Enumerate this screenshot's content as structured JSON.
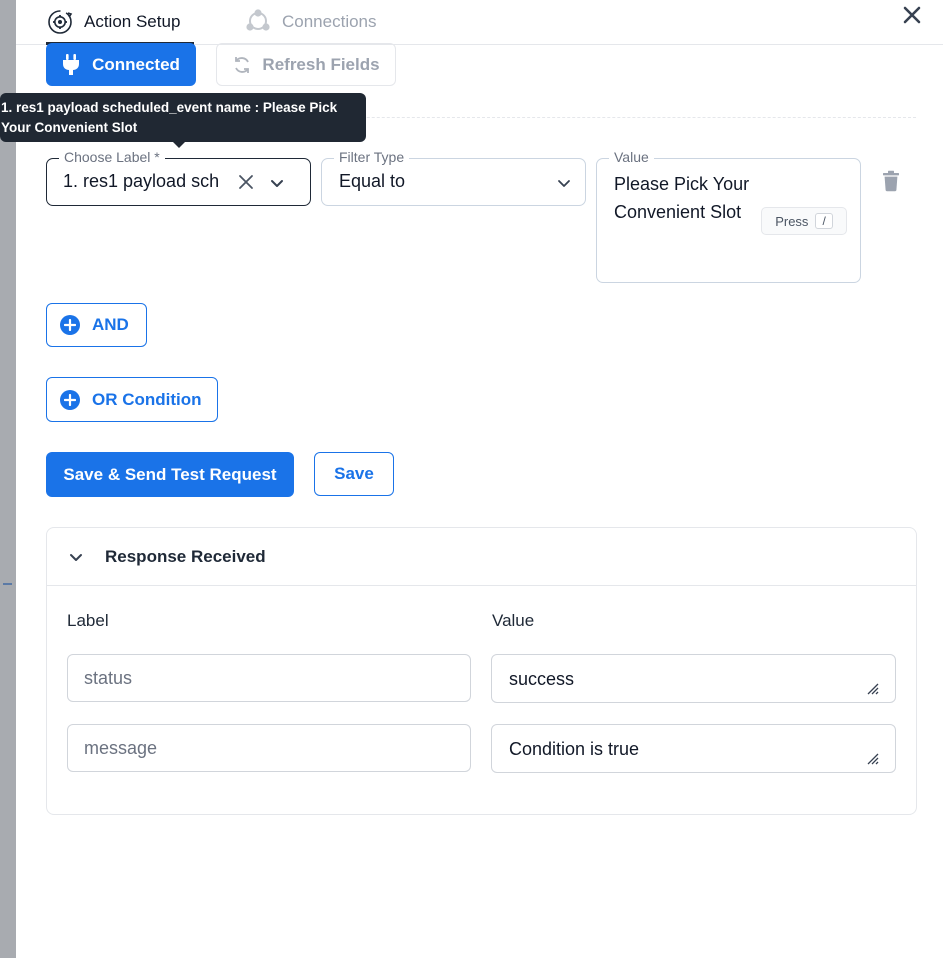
{
  "tabs": {
    "action_setup": "Action Setup",
    "connections": "Connections"
  },
  "toolbar": {
    "connected_label": "Connected",
    "refresh_label": "Refresh Fields"
  },
  "tooltip": {
    "line1": "1. res1 payload scheduled_event name : Please Pick",
    "line2": "Your Convenient Slot"
  },
  "condition": {
    "label_legend": "Choose Label *",
    "label_value": "1. res1 payload scheduled_event name",
    "filter_legend": "Filter Type",
    "filter_value": "Equal to",
    "value_legend": "Value",
    "value_text": "Please Pick Your Convenient Slot",
    "press_hint": "Press",
    "press_key": "/"
  },
  "buttons": {
    "and_label": "AND",
    "or_label": "OR Condition",
    "save_send_label": "Save & Send Test Request",
    "save_label": "Save"
  },
  "response": {
    "title": "Response Received",
    "col_label": "Label",
    "col_value": "Value",
    "rows": [
      {
        "label_placeholder": "status",
        "value": "success"
      },
      {
        "label_placeholder": "message",
        "value": "Condition is true"
      }
    ]
  },
  "colors": {
    "accent": "#1a73e8",
    "tooltip_bg": "#202833",
    "muted": "#9ca3af"
  },
  "icons": {
    "action_setup": "gear-cycle-icon",
    "connections": "network-icon",
    "close": "close-icon",
    "connected": "plug-icon",
    "refresh": "refresh-icon",
    "clear": "clear-x-icon",
    "dropdown": "chevron-down-icon",
    "delete": "trash-icon",
    "add": "plus-circle-icon",
    "collapse": "chevron-down-icon",
    "resize": "resize-grip-icon"
  }
}
